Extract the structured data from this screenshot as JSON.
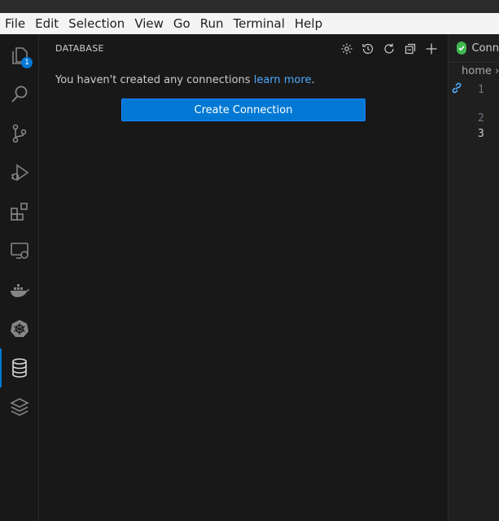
{
  "menu": [
    "File",
    "Edit",
    "Selection",
    "View",
    "Go",
    "Run",
    "Terminal",
    "Help"
  ],
  "activity": {
    "badge": "1",
    "items": [
      "explorer-icon",
      "search-icon",
      "source-control-icon",
      "run-debug-icon",
      "extensions-icon",
      "remote-explorer-icon",
      "docker-icon",
      "kubernetes-icon",
      "database-icon",
      "layers-icon"
    ],
    "active": "database-icon"
  },
  "sidebar": {
    "title": "DATABASE",
    "actions": [
      "settings-icon",
      "history-icon",
      "refresh-icon",
      "collapse-all-icon",
      "add-icon"
    ],
    "message": "You haven't created any connections ",
    "link": "learn more",
    "message_end": ".",
    "create_button": "Create Connection"
  },
  "editor": {
    "tab_label": "Conn",
    "breadcrumb": "home",
    "line_numbers": [
      "1",
      "2",
      "3"
    ],
    "active_line": "3"
  },
  "colors": {
    "accent": "#0078d4",
    "link": "#4daafc",
    "check": "#3fb950"
  }
}
